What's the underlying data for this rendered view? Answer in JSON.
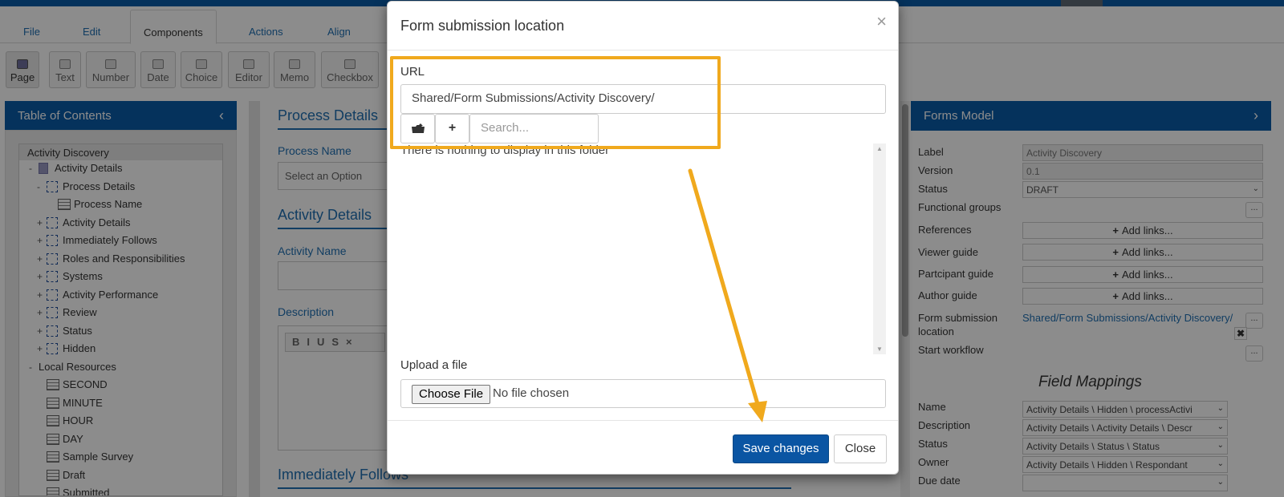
{
  "menu": {
    "tabs": [
      "File",
      "Edit",
      "Components",
      "Actions",
      "Align"
    ],
    "active": "Components"
  },
  "toolbar": {
    "items": [
      "Page",
      "Text",
      "Number",
      "Date",
      "Choice",
      "Editor",
      "Memo",
      "Checkbox"
    ]
  },
  "toc": {
    "title": "Table of Contents",
    "root": "Activity Discovery",
    "rows": [
      {
        "toggle": "-",
        "icon": "page",
        "label": "Activity Details"
      },
      {
        "toggle": "-",
        "icon": "box",
        "label": "Process Details"
      },
      {
        "toggle": "",
        "icon": "form",
        "label": "Process Name"
      },
      {
        "toggle": "+",
        "icon": "box",
        "label": "Activity Details"
      },
      {
        "toggle": "+",
        "icon": "box",
        "label": "Immediately Follows"
      },
      {
        "toggle": "+",
        "icon": "box",
        "label": "Roles and Responsibilities"
      },
      {
        "toggle": "+",
        "icon": "box",
        "label": "Systems"
      },
      {
        "toggle": "+",
        "icon": "box",
        "label": "Activity Performance"
      },
      {
        "toggle": "+",
        "icon": "box",
        "label": "Review"
      },
      {
        "toggle": "+",
        "icon": "box",
        "label": "Status"
      },
      {
        "toggle": "+",
        "icon": "box",
        "label": "Hidden"
      },
      {
        "toggle": "-",
        "icon": "none",
        "label": "Local Resources"
      },
      {
        "toggle": "",
        "icon": "form",
        "label": "SECOND"
      },
      {
        "toggle": "",
        "icon": "form",
        "label": "MINUTE"
      },
      {
        "toggle": "",
        "icon": "form",
        "label": "HOUR"
      },
      {
        "toggle": "",
        "icon": "form",
        "label": "DAY"
      },
      {
        "toggle": "",
        "icon": "form",
        "label": "Sample Survey"
      },
      {
        "toggle": "",
        "icon": "form",
        "label": "Draft"
      },
      {
        "toggle": "",
        "icon": "form",
        "label": "Submitted"
      }
    ]
  },
  "center": {
    "process_details": "Process Details",
    "process_name_label": "Process Name",
    "process_name_placeholder": "Select an Option",
    "activity_details": "Activity Details",
    "activity_name_label": "Activity Name",
    "description_label": "Description",
    "editor_buttons": "BIUS×",
    "immediately_follows": "Immediately Follows"
  },
  "forms_model": {
    "title": "Forms Model",
    "label_label": "Label",
    "label_value": "Activity Discovery",
    "version_label": "Version",
    "version_value": "0.1",
    "status_label": "Status",
    "status_value": "DRAFT",
    "functional_groups_label": "Functional groups",
    "references_label": "References",
    "viewer_guide_label": "Viewer guide",
    "participant_guide_label": "Partcipant guide",
    "author_guide_label": "Author guide",
    "add_links": "Add links...",
    "submission_label_1": "Form submission",
    "submission_label_2": "location",
    "submission_value": "Shared/Form Submissions/Activity Discovery/",
    "start_workflow_label": "Start workflow",
    "dots": "...",
    "field_mappings_title": "Field Mappings",
    "mappings": [
      {
        "label": "Name",
        "value": "Activity Details \\ Hidden \\ processActivi"
      },
      {
        "label": "Description",
        "value": "Activity Details \\ Activity Details \\ Descr"
      },
      {
        "label": "Status",
        "value": "Activity Details \\ Status \\ Status"
      },
      {
        "label": "Owner",
        "value": "Activity Details \\ Hidden \\ Respondant"
      },
      {
        "label": "Due date",
        "value": ""
      }
    ]
  },
  "modal": {
    "title": "Form submission location",
    "close_glyph": "×",
    "url_label": "URL",
    "url_value": "Shared/Form Submissions/Activity Discovery/",
    "search_placeholder": "Search...",
    "empty_message": "There is nothing to display in this folder",
    "upload_label": "Upload a file",
    "choose_file": "Choose File",
    "no_file": "No file chosen",
    "save": "Save changes",
    "close": "Close"
  },
  "colors": {
    "brand": "#0a5ba8",
    "highlight": "#f0a91d",
    "primary_button": "#0a55a3"
  },
  "icons": {
    "folder_up": "cloud-folder-icon",
    "add": "plus-icon",
    "collapse": "chevron-left-icon",
    "expand": "chevron-right-icon"
  }
}
